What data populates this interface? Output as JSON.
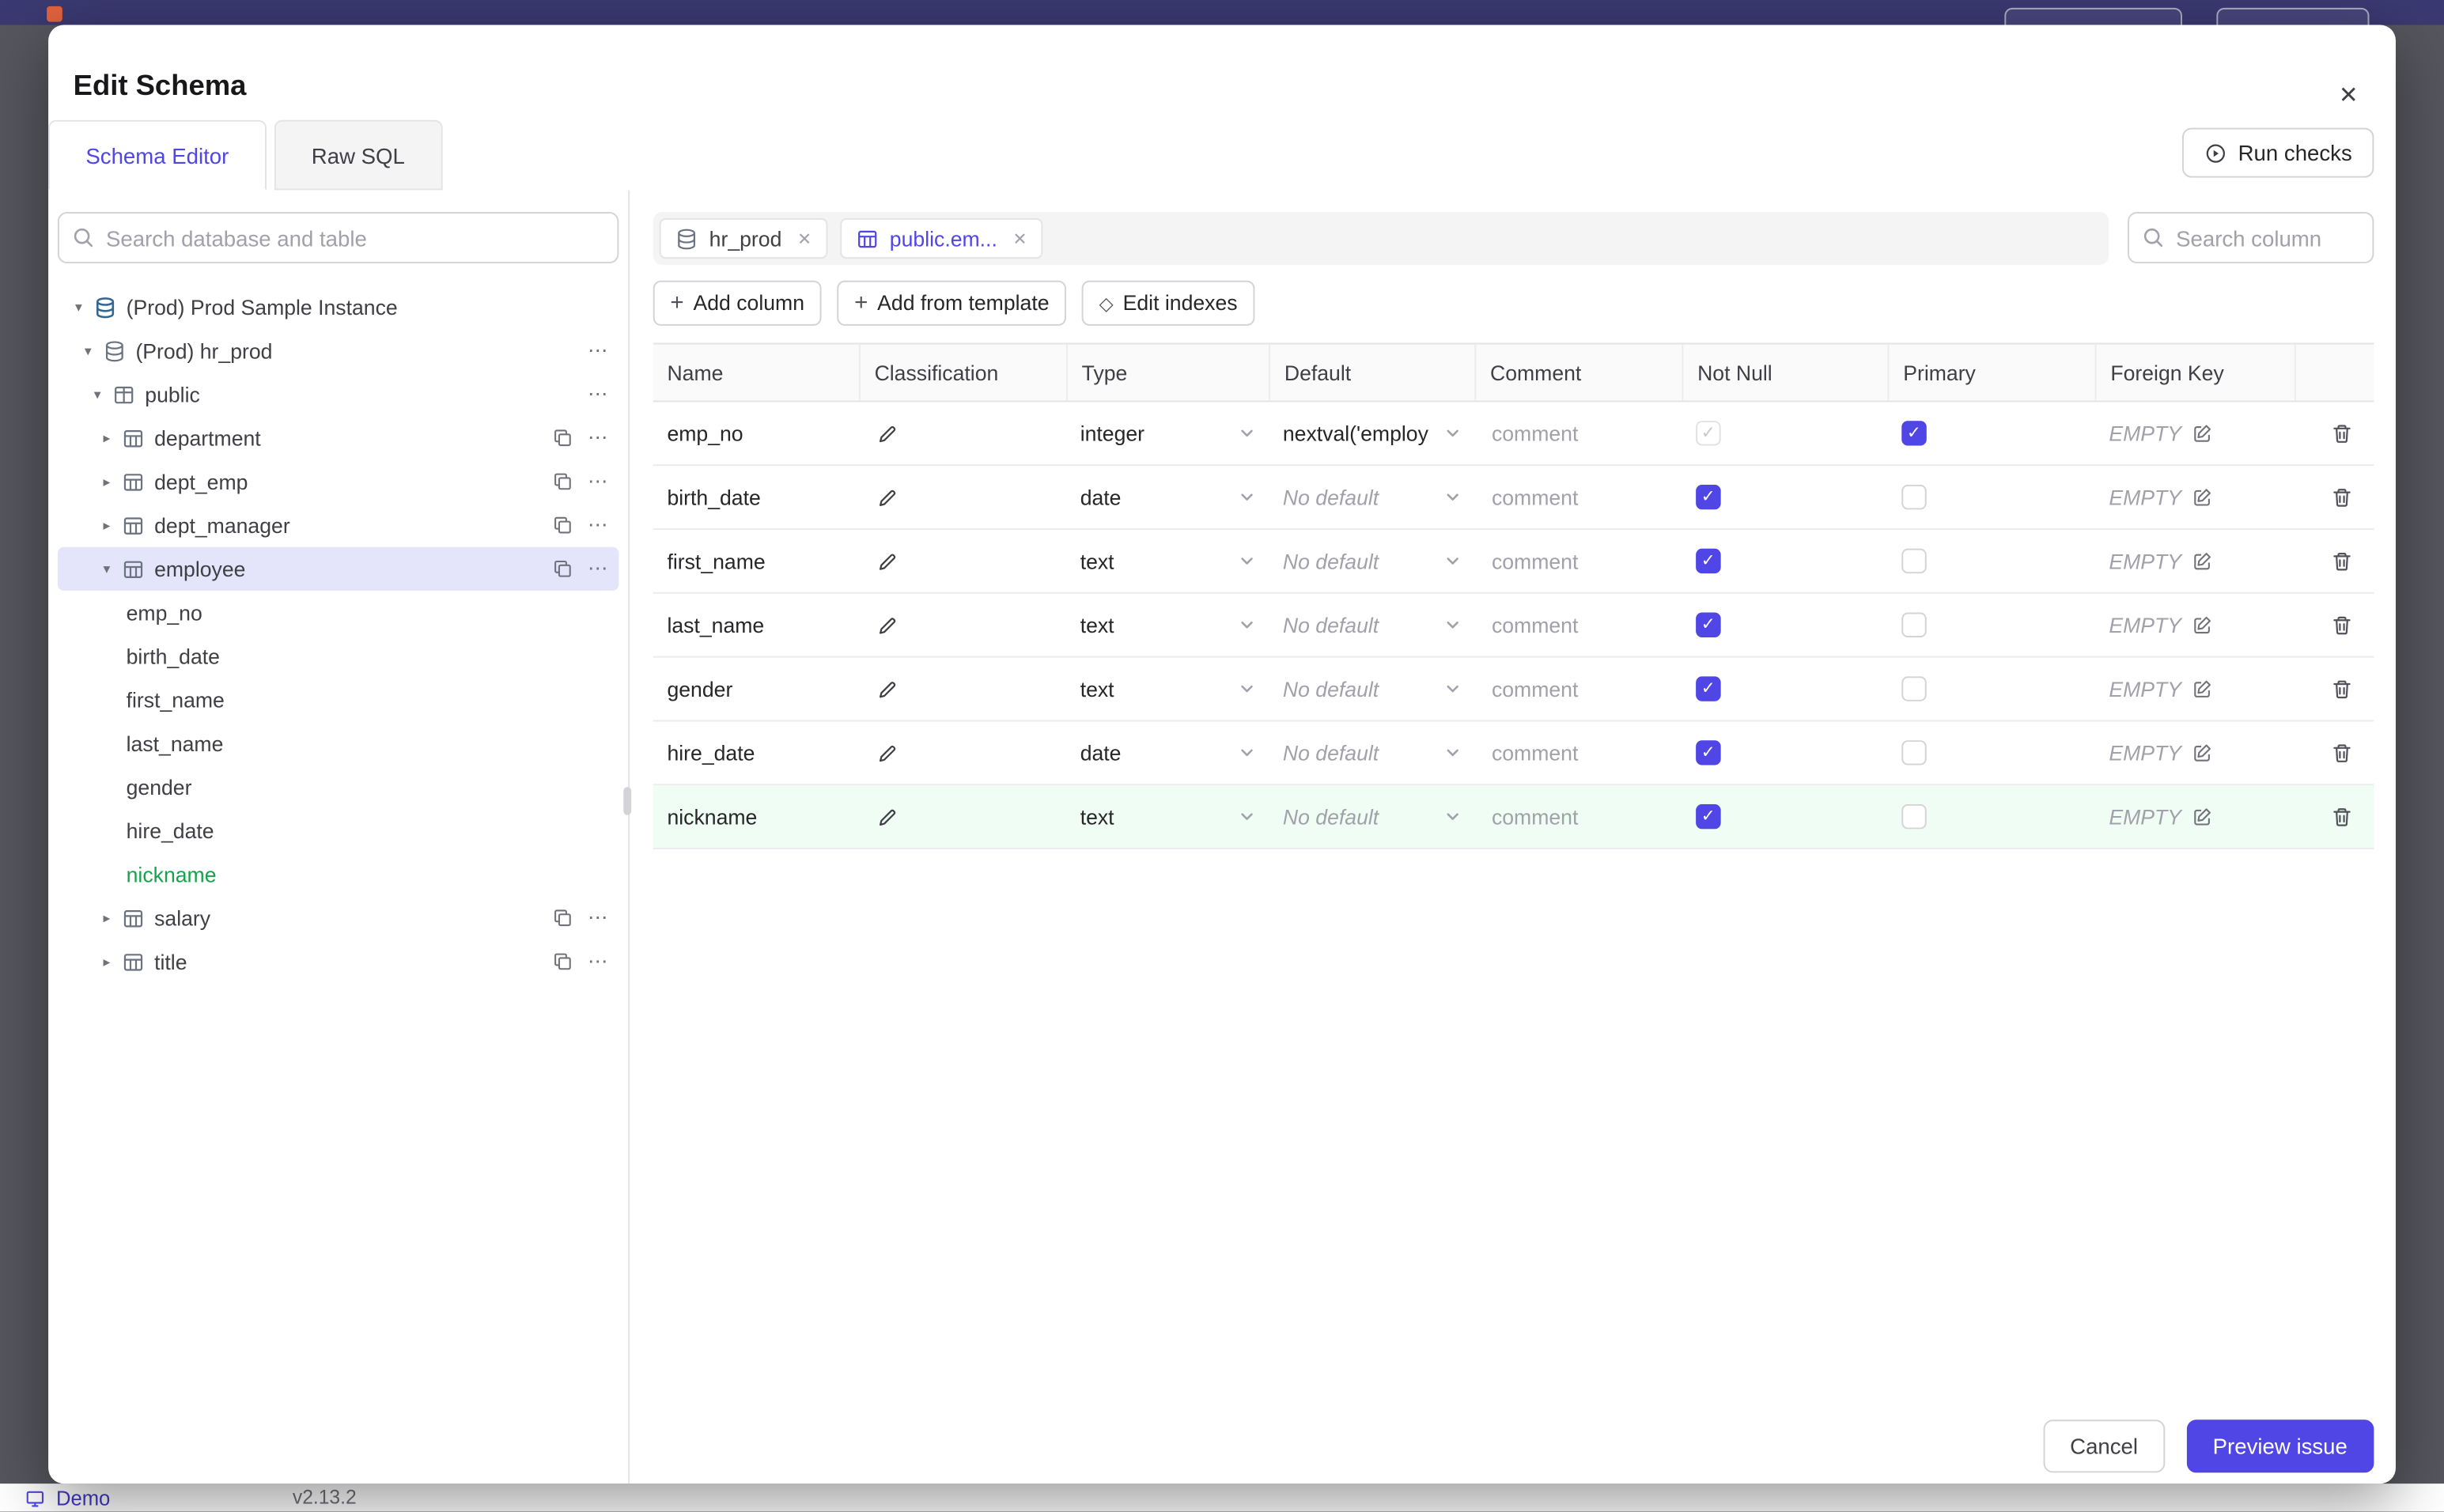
{
  "backdrop": {
    "footer": {
      "demo": "Demo",
      "version": "v2.13.2"
    }
  },
  "modal": {
    "title": "Edit Schema",
    "tabs": [
      {
        "label": "Schema Editor"
      },
      {
        "label": "Raw SQL"
      }
    ],
    "run_checks": "Run checks"
  },
  "sidebar": {
    "search_placeholder": "Search database and table",
    "tree": [
      {
        "label": "(Prod) Prod Sample Instance",
        "icon": "instance",
        "indent": 0,
        "arrow": "down",
        "actions": []
      },
      {
        "label": "(Prod) hr_prod",
        "icon": "database",
        "indent": 1,
        "arrow": "down",
        "actions": [
          "more"
        ]
      },
      {
        "label": "public",
        "icon": "schema",
        "indent": 2,
        "arrow": "down",
        "actions": [
          "more"
        ]
      },
      {
        "label": "department",
        "icon": "table",
        "indent": 3,
        "arrow": "right",
        "actions": [
          "copy",
          "more"
        ]
      },
      {
        "label": "dept_emp",
        "icon": "table",
        "indent": 3,
        "arrow": "right",
        "actions": [
          "copy",
          "more"
        ]
      },
      {
        "label": "dept_manager",
        "icon": "table",
        "indent": 3,
        "arrow": "right",
        "actions": [
          "copy",
          "more"
        ]
      },
      {
        "label": "employee",
        "icon": "table",
        "indent": 3,
        "arrow": "down",
        "selected": true,
        "actions": [
          "copy",
          "more"
        ]
      },
      {
        "label": "emp_no",
        "column": true
      },
      {
        "label": "birth_date",
        "column": true
      },
      {
        "label": "first_name",
        "column": true
      },
      {
        "label": "last_name",
        "column": true
      },
      {
        "label": "gender",
        "column": true
      },
      {
        "label": "hire_date",
        "column": true
      },
      {
        "label": "nickname",
        "column": true,
        "green": true
      },
      {
        "label": "salary",
        "icon": "table",
        "indent": 3,
        "arrow": "right",
        "actions": [
          "copy",
          "more"
        ]
      },
      {
        "label": "title",
        "icon": "table",
        "indent": 3,
        "arrow": "right",
        "actions": [
          "copy",
          "more"
        ]
      }
    ]
  },
  "editor": {
    "tabs": [
      {
        "label": "hr_prod",
        "icon": "database"
      },
      {
        "label": "public.em...",
        "icon": "table",
        "active": true
      }
    ],
    "search_placeholder": "Search column",
    "toolbar": [
      {
        "label": "Add column",
        "icon": "plus"
      },
      {
        "label": "Add from template",
        "icon": "plus"
      },
      {
        "label": "Edit indexes",
        "icon": "diamond"
      }
    ],
    "columns": [
      "Name",
      "Classification",
      "Type",
      "Default",
      "Comment",
      "Not Null",
      "Primary",
      "Foreign Key"
    ],
    "comment_placeholder": "comment",
    "fk_empty": "EMPTY",
    "rows": [
      {
        "name": "emp_no",
        "type": "integer",
        "default": "nextval('employ",
        "default_muted": false,
        "not_null": "checked-disabled",
        "primary": "checked",
        "highlight": false
      },
      {
        "name": "birth_date",
        "type": "date",
        "default": "No default",
        "default_muted": true,
        "not_null": "checked",
        "primary": "unchecked",
        "highlight": false
      },
      {
        "name": "first_name",
        "type": "text",
        "default": "No default",
        "default_muted": true,
        "not_null": "checked",
        "primary": "unchecked",
        "highlight": false
      },
      {
        "name": "last_name",
        "type": "text",
        "default": "No default",
        "default_muted": true,
        "not_null": "checked",
        "primary": "unchecked",
        "highlight": false
      },
      {
        "name": "gender",
        "type": "text",
        "default": "No default",
        "default_muted": true,
        "not_null": "checked",
        "primary": "unchecked",
        "highlight": false
      },
      {
        "name": "hire_date",
        "type": "date",
        "default": "No default",
        "default_muted": true,
        "not_null": "checked",
        "primary": "unchecked",
        "highlight": false
      },
      {
        "name": "nickname",
        "type": "text",
        "default": "No default",
        "default_muted": true,
        "not_null": "checked",
        "primary": "unchecked",
        "highlight": true
      }
    ],
    "cancel": "Cancel",
    "preview": "Preview issue"
  }
}
